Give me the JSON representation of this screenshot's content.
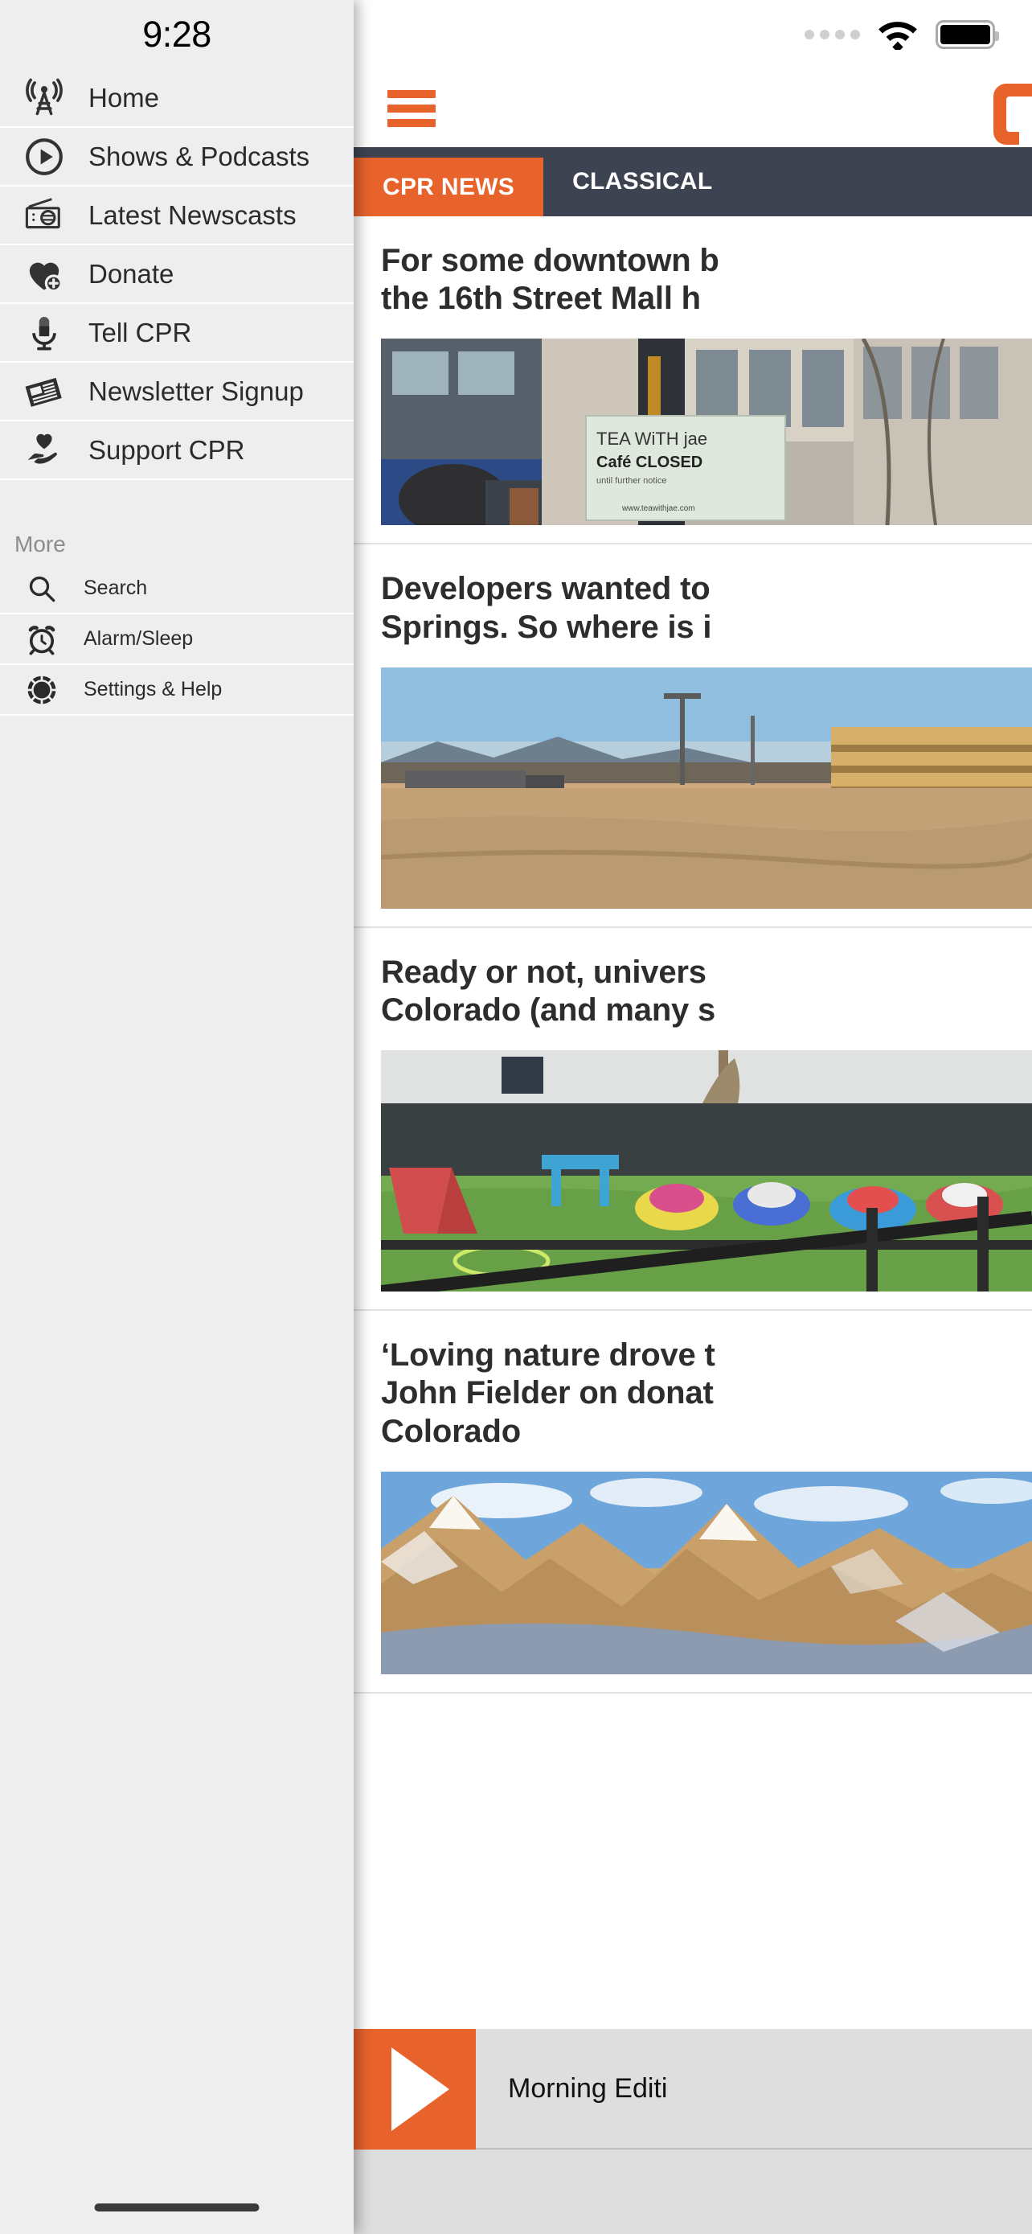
{
  "statusbar": {
    "clock": "9:28",
    "signal_icon": "signal-dots-icon",
    "wifi_icon": "wifi-icon",
    "battery_icon": "battery-icon"
  },
  "drawer": {
    "items": [
      {
        "label": "Home",
        "icon": "broadcast-tower-icon"
      },
      {
        "label": "Shows & Podcasts",
        "icon": "play-circle-icon"
      },
      {
        "label": "Latest Newscasts",
        "icon": "radio-icon"
      },
      {
        "label": "Donate",
        "icon": "heart-plus-icon"
      },
      {
        "label": "Tell CPR",
        "icon": "microphone-icon"
      },
      {
        "label": "Newsletter Signup",
        "icon": "newspaper-icon"
      },
      {
        "label": "Support CPR",
        "icon": "hand-heart-icon"
      }
    ],
    "more_header": "More",
    "more_items": [
      {
        "label": "Search",
        "icon": "search-icon"
      },
      {
        "label": "Alarm/Sleep",
        "icon": "alarm-clock-icon"
      },
      {
        "label": "Settings & Help",
        "icon": "help-circle-icon"
      }
    ]
  },
  "appbar": {
    "menu_icon": "hamburger-menu-icon",
    "logo": "cpr-logo-icon",
    "accent_color": "#e8622c"
  },
  "tabs": {
    "bar_color": "#3d4351",
    "active_color": "#e8622c",
    "items": [
      {
        "label": "CPR NEWS",
        "active": true
      },
      {
        "label": "CLASSICAL",
        "active": false
      }
    ]
  },
  "feed": {
    "articles": [
      {
        "title": "For some downtown b\nthe 16th Street Mall h",
        "image": "storefront-tea-with-jae-closed-sign"
      },
      {
        "title": "Developers wanted to\nSprings. So where is i",
        "image": "empty-lot-parking-structure-mountains"
      },
      {
        "title": "Ready or not, univers\nColorado (and many s",
        "image": "daycare-playground-toys-grass"
      },
      {
        "title": "‘Loving nature drove t\nJohn Fielder on donat\nColorado",
        "image": "snowy-mountain-peaks-blue-sky"
      }
    ]
  },
  "player": {
    "play_icon": "play-icon",
    "now_playing": "Morning Editi"
  }
}
